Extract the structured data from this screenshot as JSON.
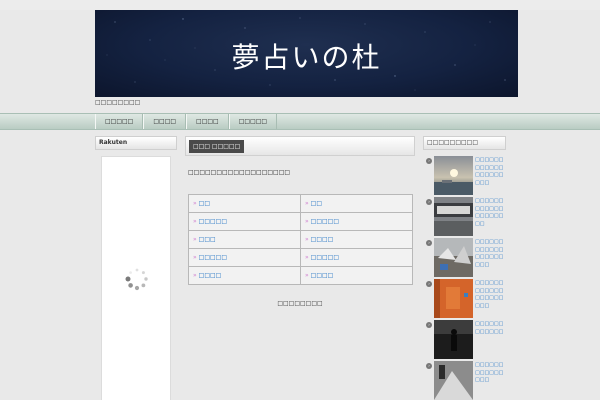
{
  "header": {
    "site_title": "夢占いの杜",
    "tagline": "□□□□□□□□"
  },
  "nav": {
    "items": [
      "□□□□□",
      "□□□□",
      "□□□□",
      "□□□□□"
    ]
  },
  "left_sidebar": {
    "widget_title": "Rakuten"
  },
  "main": {
    "title": "□□□ □□□□□",
    "intro": "□□□□□□□□□□□□□□□□□□",
    "links": [
      [
        "□□",
        "□□"
      ],
      [
        "□□□□□",
        "□□□□□"
      ],
      [
        "□□□",
        "□□□□"
      ],
      [
        "□□□□□",
        "□□□□□"
      ],
      [
        "□□□□",
        "□□□□"
      ]
    ],
    "footer_note": "□□□□□□□□"
  },
  "right_sidebar": {
    "widget_title": "□□□□□□□□□",
    "items": [
      {
        "text": "□□□□□□□□□□□□□□□□□□□□□",
        "thumb": "sunset-beach"
      },
      {
        "text": "□□□□□□□□□□□□□□□□□□□□",
        "thumb": "ship-wreck"
      },
      {
        "text": "□□□□□□□□□□□□□□□□□□□□□",
        "thumb": "debris-ruins"
      },
      {
        "text": "□□□□□□□□□□□□□□□□□□□□□",
        "thumb": "orange-door"
      },
      {
        "text": "□□□□□□□□□□□□",
        "thumb": "dark-figure"
      },
      {
        "text": "□□□□□□□□□□□□□□□",
        "thumb": "bw-street"
      }
    ]
  },
  "colors": {
    "link": "#1a6fc2",
    "bullet": "#d080d0",
    "nav_band": "#b9ccc3",
    "banner": "#142241"
  }
}
